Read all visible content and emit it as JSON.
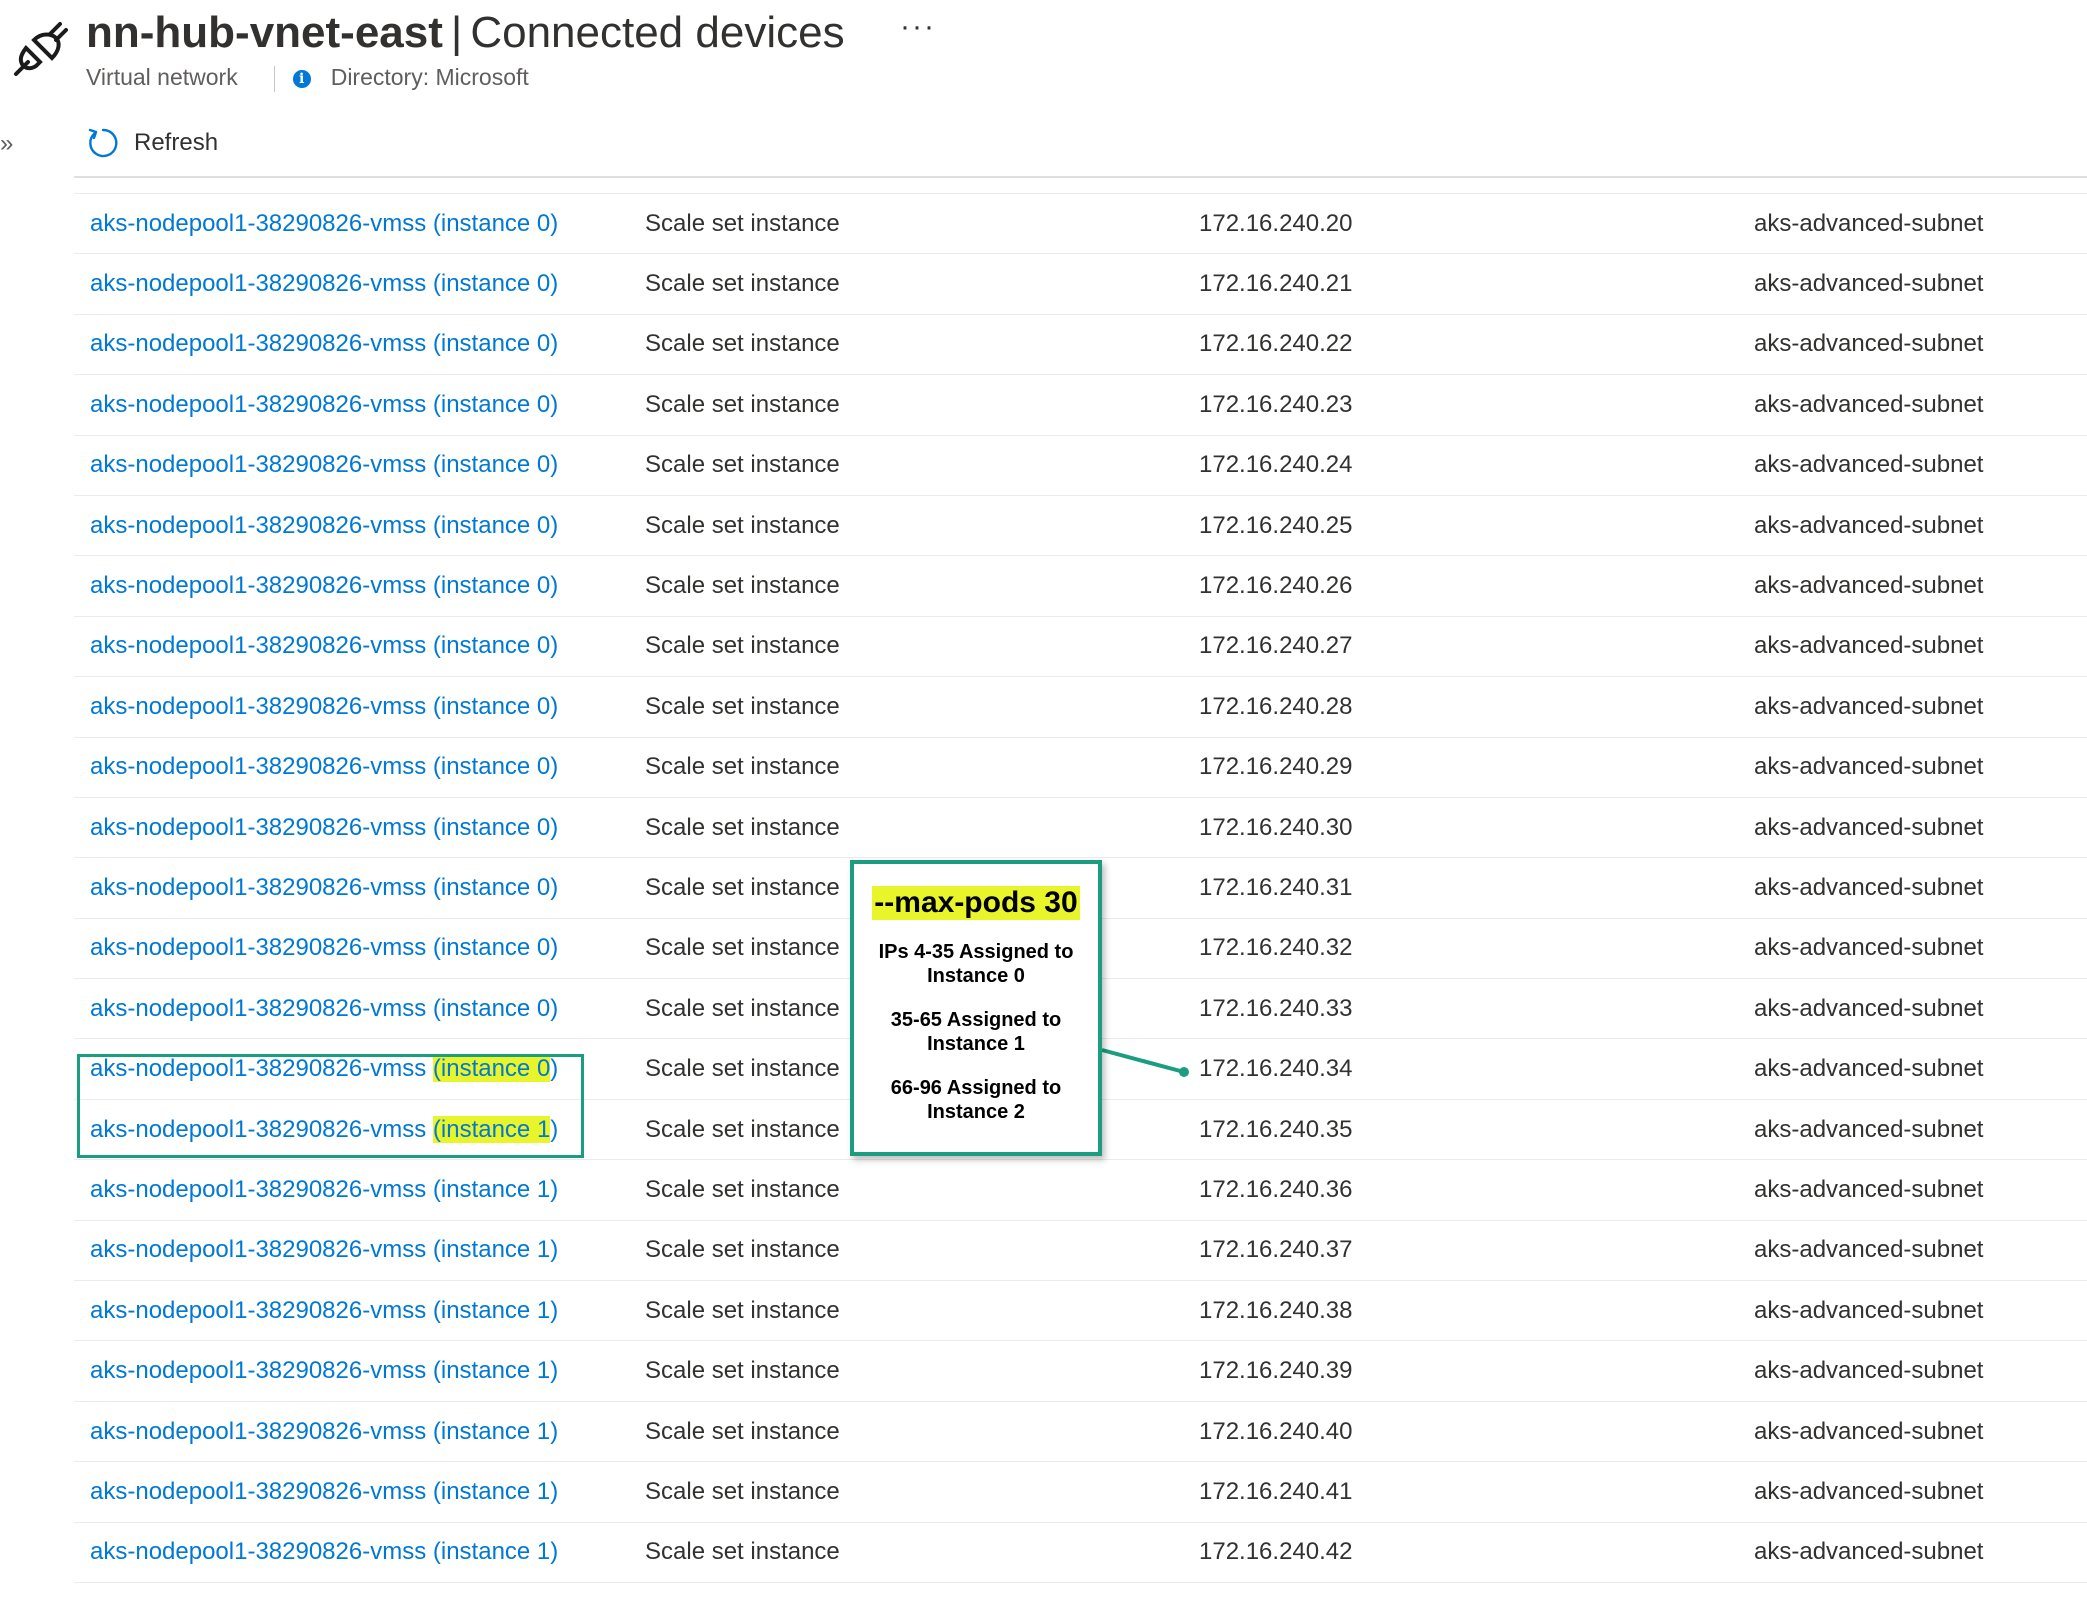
{
  "header": {
    "resource_name": "nn-hub-vnet-east",
    "separator": "|",
    "page_name": "Connected devices",
    "more_label": "···",
    "resource_type": "Virtual network",
    "directory": "Directory: Microsoft",
    "icon": "plug-icon"
  },
  "toolbar": {
    "refresh_label": "Refresh",
    "refresh_icon": "refresh-icon",
    "expand_icon": "»"
  },
  "table": {
    "rows": [
      {
        "name": "aks-nodepool1-38290826-vmss (instance 0)",
        "type": "Scale set instance",
        "ip": "172.16.240.20",
        "subnet": "aks-advanced-subnet"
      },
      {
        "name": "aks-nodepool1-38290826-vmss (instance 0)",
        "type": "Scale set instance",
        "ip": "172.16.240.21",
        "subnet": "aks-advanced-subnet"
      },
      {
        "name": "aks-nodepool1-38290826-vmss (instance 0)",
        "type": "Scale set instance",
        "ip": "172.16.240.22",
        "subnet": "aks-advanced-subnet"
      },
      {
        "name": "aks-nodepool1-38290826-vmss (instance 0)",
        "type": "Scale set instance",
        "ip": "172.16.240.23",
        "subnet": "aks-advanced-subnet"
      },
      {
        "name": "aks-nodepool1-38290826-vmss (instance 0)",
        "type": "Scale set instance",
        "ip": "172.16.240.24",
        "subnet": "aks-advanced-subnet"
      },
      {
        "name": "aks-nodepool1-38290826-vmss (instance 0)",
        "type": "Scale set instance",
        "ip": "172.16.240.25",
        "subnet": "aks-advanced-subnet"
      },
      {
        "name": "aks-nodepool1-38290826-vmss (instance 0)",
        "type": "Scale set instance",
        "ip": "172.16.240.26",
        "subnet": "aks-advanced-subnet"
      },
      {
        "name": "aks-nodepool1-38290826-vmss (instance 0)",
        "type": "Scale set instance",
        "ip": "172.16.240.27",
        "subnet": "aks-advanced-subnet"
      },
      {
        "name": "aks-nodepool1-38290826-vmss (instance 0)",
        "type": "Scale set instance",
        "ip": "172.16.240.28",
        "subnet": "aks-advanced-subnet"
      },
      {
        "name": "aks-nodepool1-38290826-vmss (instance 0)",
        "type": "Scale set instance",
        "ip": "172.16.240.29",
        "subnet": "aks-advanced-subnet"
      },
      {
        "name": "aks-nodepool1-38290826-vmss (instance 0)",
        "type": "Scale set instance",
        "ip": "172.16.240.30",
        "subnet": "aks-advanced-subnet"
      },
      {
        "name": "aks-nodepool1-38290826-vmss (instance 0)",
        "type": "Scale set instance",
        "ip": "172.16.240.31",
        "subnet": "aks-advanced-subnet"
      },
      {
        "name": "aks-nodepool1-38290826-vmss (instance 0)",
        "type": "Scale set instance",
        "ip": "172.16.240.32",
        "subnet": "aks-advanced-subnet"
      },
      {
        "name": "aks-nodepool1-38290826-vmss (instance 0)",
        "type": "Scale set instance",
        "ip": "172.16.240.33",
        "subnet": "aks-advanced-subnet"
      },
      {
        "name_prefix": "aks-nodepool1-38290826-vmss ",
        "name_highlight": "(instance 0",
        "name_suffix": ")",
        "type": "Scale set instance",
        "ip": "172.16.240.34",
        "subnet": "aks-advanced-subnet"
      },
      {
        "name_prefix": "aks-nodepool1-38290826-vmss ",
        "name_highlight": "(instance 1",
        "name_suffix": ")",
        "type": "Scale set instance",
        "ip": "172.16.240.35",
        "subnet": "aks-advanced-subnet"
      },
      {
        "name": "aks-nodepool1-38290826-vmss (instance 1)",
        "type": "Scale set instance",
        "ip": "172.16.240.36",
        "subnet": "aks-advanced-subnet"
      },
      {
        "name": "aks-nodepool1-38290826-vmss (instance 1)",
        "type": "Scale set instance",
        "ip": "172.16.240.37",
        "subnet": "aks-advanced-subnet"
      },
      {
        "name": "aks-nodepool1-38290826-vmss (instance 1)",
        "type": "Scale set instance",
        "ip": "172.16.240.38",
        "subnet": "aks-advanced-subnet"
      },
      {
        "name": "aks-nodepool1-38290826-vmss (instance 1)",
        "type": "Scale set instance",
        "ip": "172.16.240.39",
        "subnet": "aks-advanced-subnet"
      },
      {
        "name": "aks-nodepool1-38290826-vmss (instance 1)",
        "type": "Scale set instance",
        "ip": "172.16.240.40",
        "subnet": "aks-advanced-subnet"
      },
      {
        "name": "aks-nodepool1-38290826-vmss (instance 1)",
        "type": "Scale set instance",
        "ip": "172.16.240.41",
        "subnet": "aks-advanced-subnet"
      },
      {
        "name": "aks-nodepool1-38290826-vmss (instance 1)",
        "type": "Scale set instance",
        "ip": "172.16.240.42",
        "subnet": "aks-advanced-subnet"
      }
    ]
  },
  "callout": {
    "title": "--max-pods 30",
    "line1": "IPs 4-35 Assigned to Instance 0",
    "line2": "35-65 Assigned to Instance 1",
    "line3": "66-96 Assigned to Instance 2"
  },
  "colors": {
    "link": "#0078d4",
    "highlight": "#e8f52a",
    "annotation_green": "#1b9e80",
    "text": "#323130"
  }
}
